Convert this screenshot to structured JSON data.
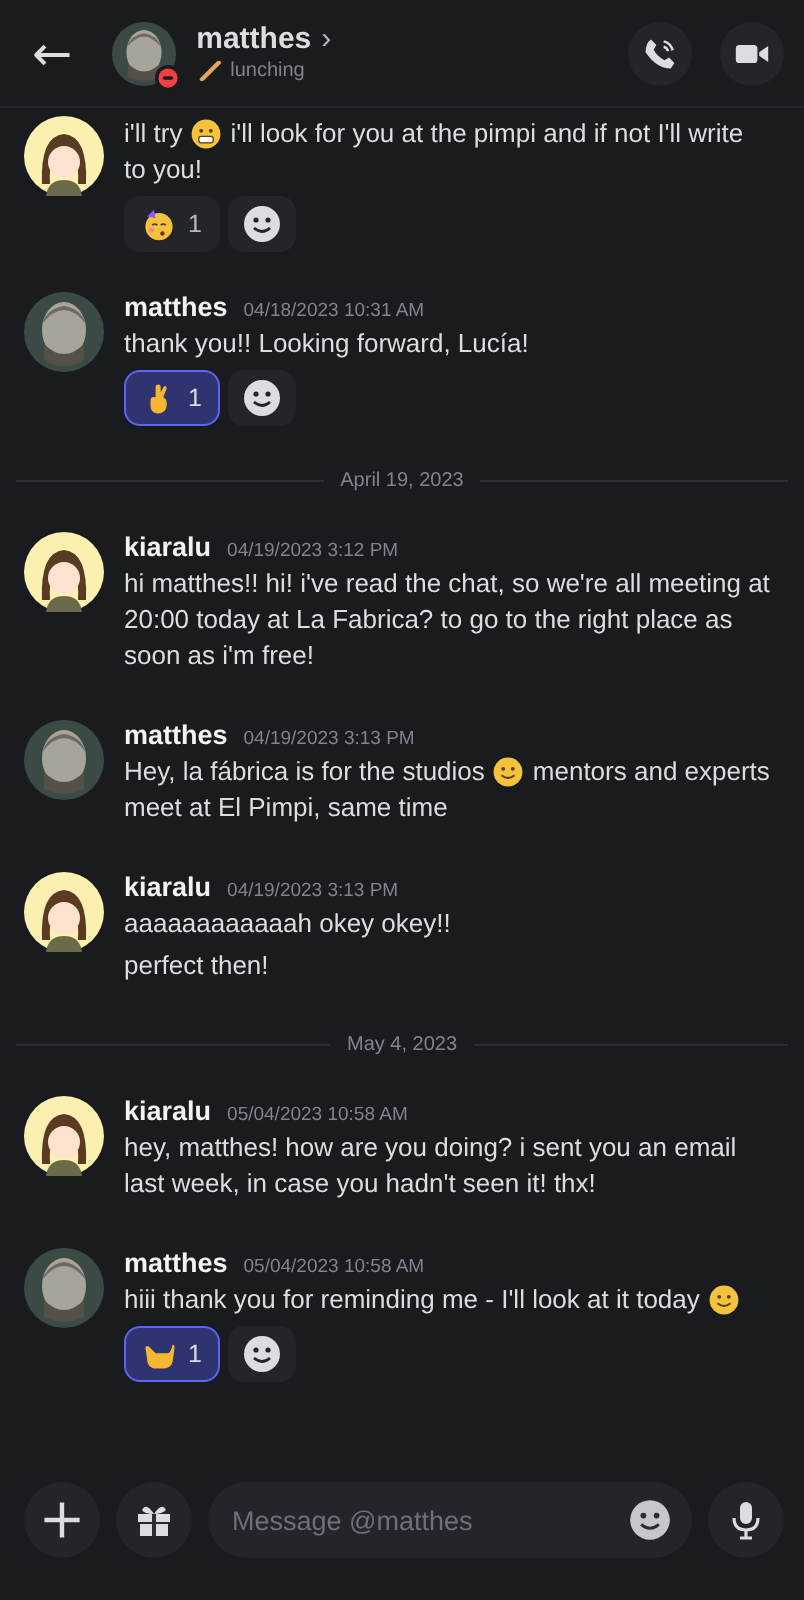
{
  "header": {
    "back": "←",
    "name": "matthes",
    "chevron": "›",
    "do_not_disturb": true,
    "status": "lunching"
  },
  "messages": [
    {
      "kind": "message",
      "avatar": {
        "kind": "cartoon"
      },
      "lines": [
        [
          {
            "kind": "text",
            "text": "i'll try"
          },
          {
            "kind": "grimace"
          },
          {
            "kind": "text",
            "text": "i'll look for you at the pimpi and if not I'll write"
          },
          {
            "kind": "text",
            "text": "to you!"
          }
        ]
      ],
      "reactions": [
        {
          "kind": "party",
          "count": "1",
          "selected": false
        }
      ]
    },
    {
      "kind": "message",
      "avatar": {
        "kind": "photo"
      },
      "author": "matthes",
      "time": "04/18/2023 10:31 AM",
      "lines": [
        [
          {
            "kind": "text",
            "text": "thank you!! Looking forward, Lucía!"
          }
        ]
      ],
      "reactions": [
        {
          "kind": "crossed",
          "count": "1",
          "selected": true
        }
      ]
    },
    {
      "kind": "divider",
      "label": "April 19, 2023"
    },
    {
      "kind": "message",
      "avatar": {
        "kind": "cartoon"
      },
      "author": "kiaralu",
      "time": "04/19/2023 3:12 PM",
      "lines": [
        [
          {
            "kind": "text",
            "text": "hi matthes!! hi! i've read the chat, so we're all meeting at 20:00 today at La Fabrica? to go to the right place as soon as i'm free!"
          }
        ]
      ]
    },
    {
      "kind": "message",
      "avatar": {
        "kind": "photo"
      },
      "author": "matthes",
      "time": "04/19/2023 3:13 PM",
      "lines": [
        [
          {
            "kind": "text",
            "text": "Hey, la fábrica is for the studios"
          },
          {
            "kind": "smile"
          },
          {
            "kind": "text",
            "text": "mentors and experts"
          },
          {
            "kind": "text",
            "text": "meet at El Pimpi, same time"
          }
        ]
      ]
    },
    {
      "kind": "message",
      "avatar": {
        "kind": "cartoon"
      },
      "author": "kiaralu",
      "time": "04/19/2023 3:13 PM",
      "lines": [
        [
          {
            "kind": "text",
            "text": "aaaaaaaaaaaah okey okey!!"
          }
        ],
        [
          {
            "kind": "text",
            "text": "perfect then!"
          }
        ]
      ]
    },
    {
      "kind": "divider",
      "label": "May 4, 2023"
    },
    {
      "kind": "message",
      "avatar": {
        "kind": "cartoon"
      },
      "author": "kiaralu",
      "time": "05/04/2023 10:58 AM",
      "lines": [
        [
          {
            "kind": "text",
            "text": "hey, matthes! how are you doing? i sent you an email last week, in case you hadn't seen it! thx!"
          }
        ]
      ]
    },
    {
      "kind": "message",
      "avatar": {
        "kind": "photo"
      },
      "author": "matthes",
      "time": "05/04/2023 10:58 AM",
      "lines": [
        [
          {
            "kind": "text",
            "text": "hiii thank you for reminding me - I'll look at it today"
          },
          {
            "kind": "smile"
          }
        ]
      ],
      "reactions": [
        {
          "kind": "callme",
          "count": "1",
          "selected": true
        }
      ]
    }
  ],
  "composer": {
    "placeholder": "Message @matthes"
  }
}
